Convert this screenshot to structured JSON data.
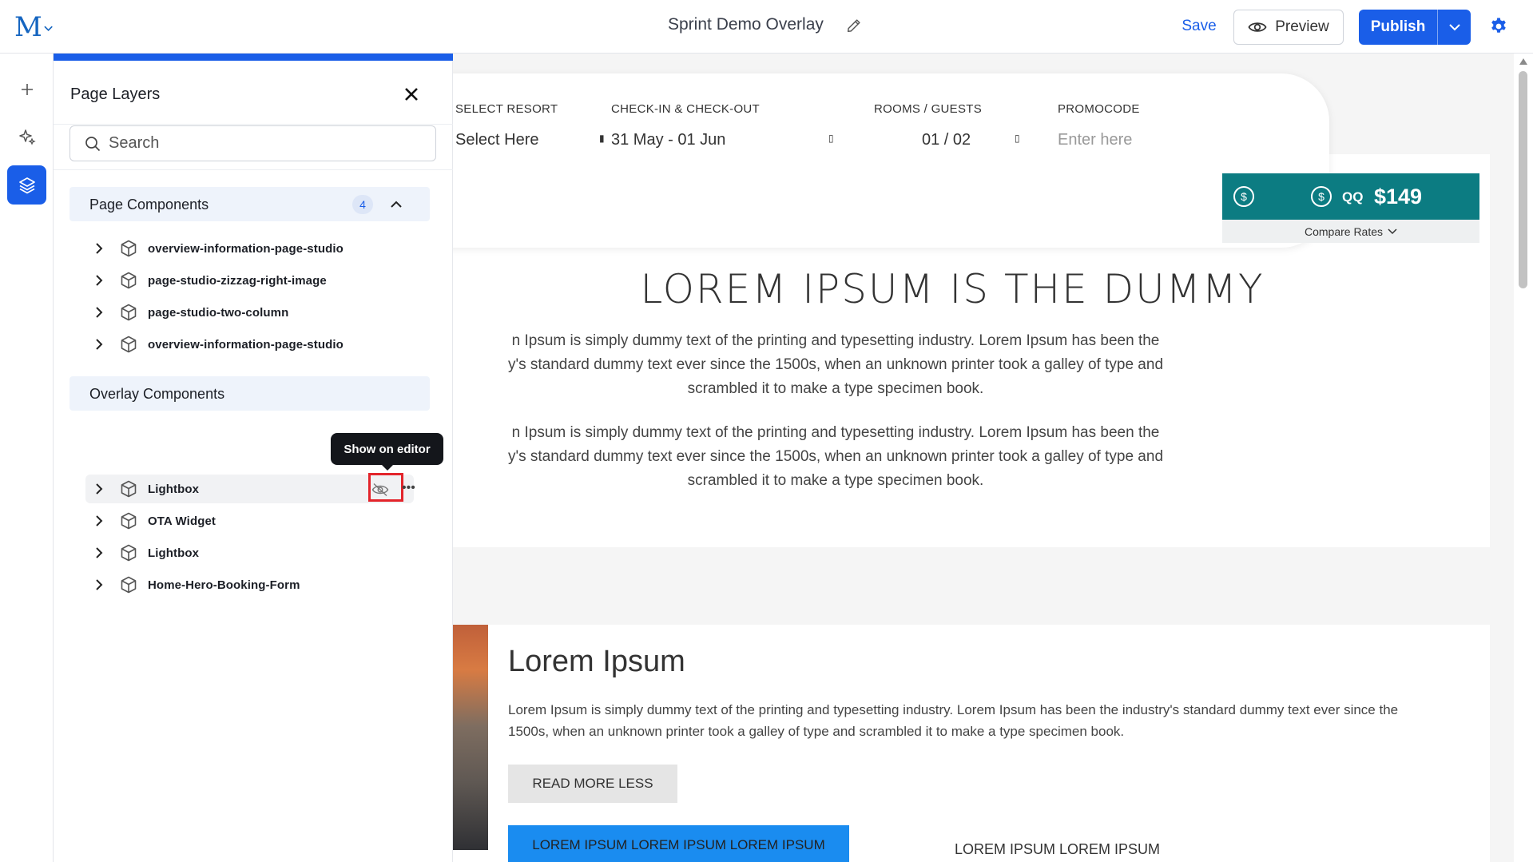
{
  "header": {
    "title": "Sprint Demo Overlay",
    "save_label": "Save",
    "preview_label": "Preview",
    "publish_label": "Publish",
    "accent": "#1a5ee8"
  },
  "rail": {
    "items": [
      "add-icon",
      "sparkles-icon",
      "layers-icon"
    ],
    "active": "layers-icon"
  },
  "panel": {
    "title": "Page Layers",
    "search_placeholder": "Search",
    "page_components": {
      "title": "Page Components",
      "count": "4",
      "items": [
        "overview-information-page-studio",
        "page-studio-zizzag-right-image",
        "page-studio-two-column",
        "overview-information-page-studio"
      ]
    },
    "overlay_components": {
      "title": "Overlay Components",
      "items": [
        "Lightbox",
        "OTA Widget",
        "Lightbox",
        "Home-Hero-Booking-Form"
      ]
    },
    "tooltip": "Show on editor"
  },
  "booking": {
    "resort_label": "SELECT RESORT",
    "resort_value": "Select Here",
    "dates_label": "CHECK-IN & CHECK-OUT",
    "dates_value": "31 May - 01 Jun",
    "rooms_label": "ROOMS / GUESTS",
    "rooms_value": "01 / 02",
    "promo_label": "PROMOCODE",
    "promo_placeholder": "Enter here"
  },
  "rate": {
    "qq": "QQ",
    "price": "$149",
    "compare": "Compare Rates",
    "color": "#0c7c82"
  },
  "content": {
    "hero_title": "LOREM IPSUM IS THE DUMMY",
    "para1": [
      "n Ipsum is simply dummy text of the printing and typesetting industry. Lorem Ipsum has been the",
      "y's standard dummy text ever since the 1500s, when an unknown printer took a galley of type and",
      "scrambled it to make a type specimen book."
    ],
    "para2": [
      "n Ipsum is simply dummy text of the printing and typesetting industry. Lorem Ipsum has been the",
      "y's standard dummy text ever since the 1500s, when an unknown printer took a galley of type and",
      "scrambled it to make a type specimen book."
    ],
    "section2_title": "Lorem Ipsum",
    "section2_body": "Lorem Ipsum is simply dummy text of the printing and typesetting industry. Lorem Ipsum has been the industry's standard dummy text ever since the 1500s, when an unknown printer took a galley of type and scrambled it to make a type specimen book.",
    "read_more": "READ MORE LESS",
    "cta_blue": "LOREM IPSUM LOREM IPSUM LOREM IPSUM",
    "cta_link": "LOREM IPSUM LOREM IPSUM"
  }
}
